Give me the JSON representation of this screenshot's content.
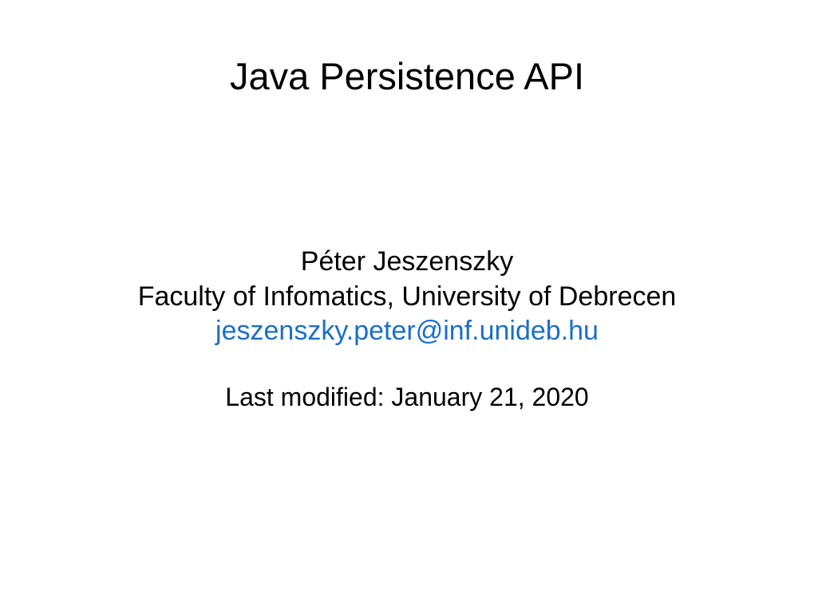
{
  "slide": {
    "title": "Java Persistence API",
    "author": "Péter Jeszenszky",
    "affiliation": "Faculty of Infomatics, University of Debrecen",
    "email": "jeszenszky.peter@inf.unideb.hu",
    "modified": "Last modified: January 21, 2020"
  }
}
